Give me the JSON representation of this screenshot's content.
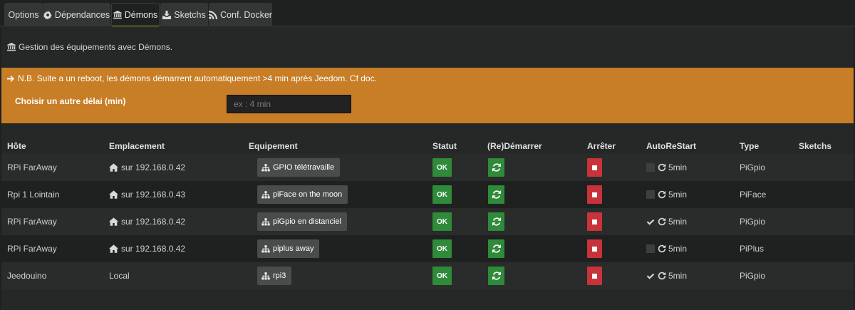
{
  "tabs": [
    {
      "label": "Options",
      "icon": "",
      "active": false
    },
    {
      "label": "Dépendances",
      "icon": "gear-icon",
      "active": false
    },
    {
      "label": "Démons",
      "icon": "bank-icon",
      "active": true
    },
    {
      "label": "Sketchs",
      "icon": "download-icon",
      "active": false
    },
    {
      "label": "Conf. Docker",
      "icon": "rss-icon",
      "active": false
    }
  ],
  "subtitle": "Gestion des équipements avec Démons.",
  "alert": {
    "note": "N.B. Suite a un reboot, les démons démarrent automatiquement >4 min après Jeedom. Cf doc.",
    "delay_label": "Choisir un autre délai (min)",
    "delay_placeholder": "ex : 4 min",
    "color": "#c77e26"
  },
  "table": {
    "headers": {
      "host": "Hôte",
      "location": "Emplacement",
      "equipment": "Equipement",
      "status": "Statut",
      "restart": "(Re)Démarrer",
      "stop": "Arrêter",
      "autorestart": "AutoReStart",
      "type": "Type",
      "sketchs": "Sketchs"
    },
    "rows": [
      {
        "host": "RPi FarAway",
        "location": "sur 192.168.0.42",
        "location_icon": "home-icon",
        "equipment": "GPIO télétravaille",
        "status": "OK",
        "autorestart_checked": false,
        "autorestart": "5min",
        "type": "PiGpio"
      },
      {
        "host": "Rpi 1 Lointain",
        "location": "sur 192.168.0.43",
        "location_icon": "home-icon",
        "equipment": "piFace on the moon",
        "status": "OK",
        "autorestart_checked": false,
        "autorestart": "5min",
        "type": "PiFace"
      },
      {
        "host": "RPi FarAway",
        "location": "sur 192.168.0.42",
        "location_icon": "home-icon",
        "equipment": "piGpio en distanciel",
        "status": "OK",
        "autorestart_checked": true,
        "autorestart": "5min",
        "type": "PiGpio"
      },
      {
        "host": "RPi FarAway",
        "location": "sur 192.168.0.42",
        "location_icon": "home-icon",
        "equipment": "piplus away",
        "status": "OK",
        "autorestart_checked": false,
        "autorestart": "5min",
        "type": "PiPlus"
      },
      {
        "host": "Jeedouino",
        "location": "Local",
        "location_icon": "",
        "equipment": "rpi3",
        "status": "OK",
        "autorestart_checked": true,
        "autorestart": "5min",
        "type": "PiGpio"
      }
    ]
  },
  "colors": {
    "ok_green": "#2f8a3a",
    "stop_red": "#c8333b",
    "active_tab_underline": "#8ab835"
  }
}
